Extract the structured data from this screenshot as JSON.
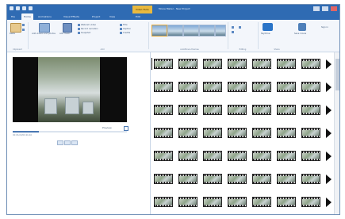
{
  "window": {
    "title": "Movie Maker - New Project",
    "context_tab": "Video Tools",
    "buttons": [
      "minimize-button",
      "maximize-button",
      "close-button"
    ]
  },
  "ribbon_tabs": [
    {
      "label": "File",
      "active": false
    },
    {
      "label": "Home",
      "active": true
    },
    {
      "label": "Animations",
      "active": false
    },
    {
      "label": "Visual Effects",
      "active": false
    },
    {
      "label": "Project",
      "active": false
    },
    {
      "label": "View",
      "active": false
    },
    {
      "label": "Edit",
      "active": false
    }
  ],
  "ribbon": {
    "clipboard": {
      "paste": "Paste",
      "label": "Clipboard"
    },
    "add": {
      "add_videos": "Add videos and photos",
      "add_music": "Add music",
      "webcam_video": "Webcam video",
      "narration": "Record narration",
      "snapshot": "Snapshot",
      "title": "Title",
      "caption": "Caption",
      "credits": "Credits",
      "label": "Add"
    },
    "themes": {
      "label": "AutoMovie themes",
      "count": 5
    },
    "editing": {
      "rotate_left": "Rotate left",
      "rotate_right": "Rotate right",
      "label": "Editing"
    },
    "share": {
      "skydrive": "SkyDrive",
      "save_movie": "Save movie",
      "sign_in": "Sign in",
      "label": "Share"
    }
  },
  "preview": {
    "time": "00:06.00/00:26.46",
    "progress": 0.23,
    "size_label": "Preview"
  },
  "storyboard": {
    "rows": 7,
    "frames_per_row": 7
  },
  "colors": {
    "title_bar": "#2f6bb3",
    "ribbon": "#f3f6fb",
    "context_tab": "#e9b93f",
    "accent": "#4a78b3"
  }
}
